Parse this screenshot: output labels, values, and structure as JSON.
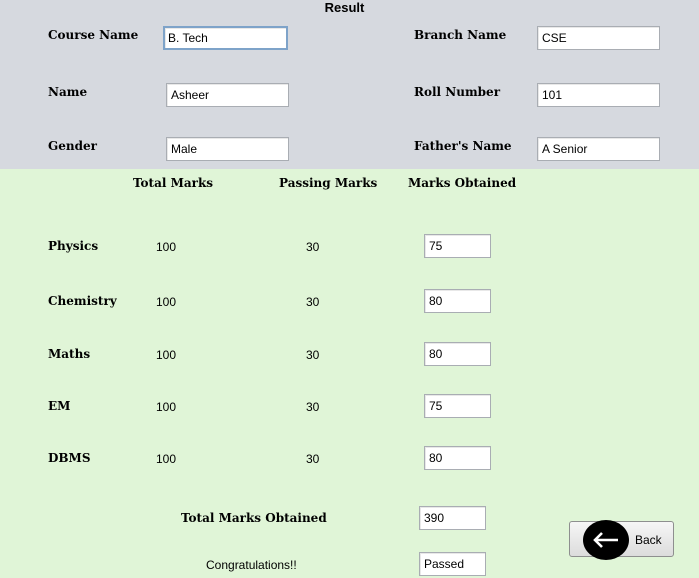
{
  "title": "Result",
  "info": {
    "course_label": "Course Name",
    "course_value": "B. Tech",
    "branch_label": "Branch Name",
    "branch_value": "CSE",
    "name_label": "Name",
    "name_value": "Asheer",
    "roll_label": "Roll Number",
    "roll_value": "101",
    "gender_label": "Gender",
    "gender_value": "Male",
    "father_label": "Father's Name",
    "father_value": "A Senior"
  },
  "headers": {
    "total": "Total Marks",
    "passing": "Passing Marks",
    "obtained": "Marks Obtained"
  },
  "subjects": [
    {
      "name": "Physics",
      "total": "100",
      "passing": "30",
      "obtained": "75"
    },
    {
      "name": "Chemistry",
      "total": "100",
      "passing": "30",
      "obtained": "80"
    },
    {
      "name": "Maths",
      "total": "100",
      "passing": "30",
      "obtained": "80"
    },
    {
      "name": "EM",
      "total": "100",
      "passing": "30",
      "obtained": "75"
    },
    {
      "name": "DBMS",
      "total": "100",
      "passing": "30",
      "obtained": "80"
    }
  ],
  "summary": {
    "total_obtained_label": "Total Marks Obtained",
    "total_obtained_value": "390",
    "message": "Congratulations!!",
    "status_value": "Passed"
  },
  "back_button": {
    "label": "Back",
    "icon": "arrow-left-icon"
  },
  "colors": {
    "top_panel": "#d6d9df",
    "bottom_panel": "#e0f5d7"
  }
}
